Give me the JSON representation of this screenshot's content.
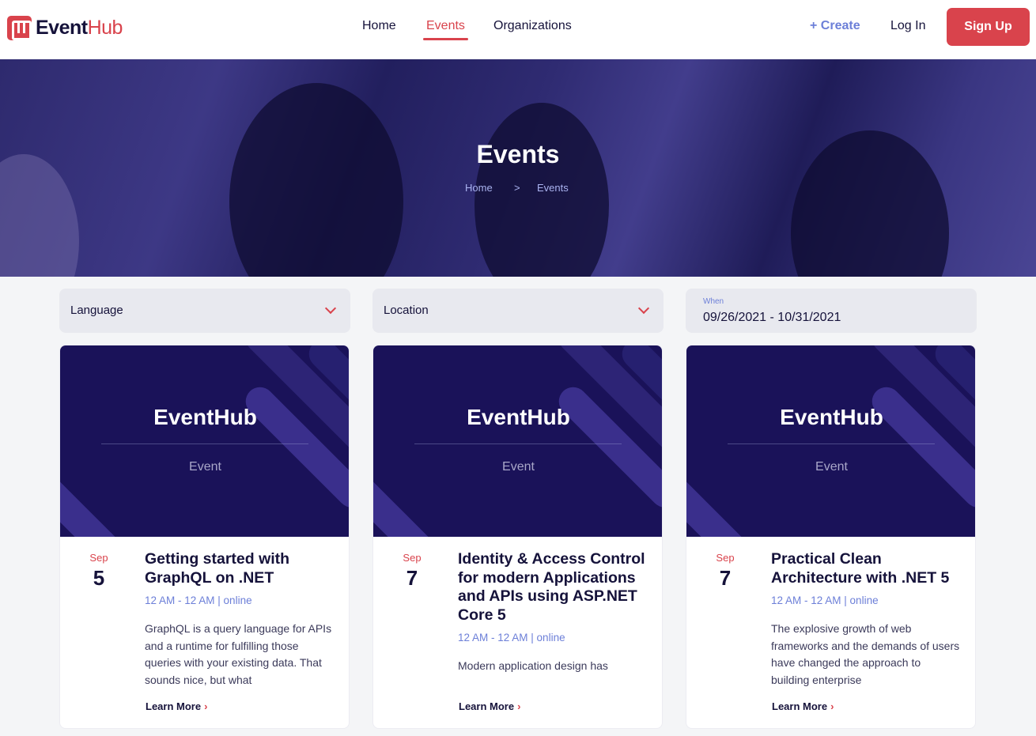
{
  "brand": {
    "name_part1": "Event",
    "name_part2": "Hub"
  },
  "nav": {
    "items": [
      "Home",
      "Events",
      "Organizations"
    ],
    "active": "Events"
  },
  "header_actions": {
    "create": "+ Create",
    "login": "Log In",
    "signup": "Sign Up"
  },
  "hero": {
    "title": "Events",
    "breadcrumb": [
      "Home",
      ">",
      "Events"
    ]
  },
  "filters": {
    "language": "Language",
    "location": "Location",
    "when_label": "When",
    "when_value": "09/26/2021 - 10/31/2021"
  },
  "cards": [
    {
      "banner_title": "EventHub",
      "banner_sub": "Event",
      "month": "Sep",
      "day": "5",
      "title": "Getting started with GraphQL on .NET",
      "meta": "12 AM - 12 AM | online",
      "description": "GraphQL is a query language for APIs and a runtime for fulfilling those queries with your existing data. That sounds nice, but what",
      "more": "Learn More"
    },
    {
      "banner_title": "EventHub",
      "banner_sub": "Event",
      "month": "Sep",
      "day": "7",
      "title": "Identity & Access Control for modern Applications and APIs using ASP.NET Core 5",
      "meta": "12 AM - 12 AM | online",
      "description": "Modern application design has",
      "more": "Learn More"
    },
    {
      "banner_title": "EventHub",
      "banner_sub": "Event",
      "month": "Sep",
      "day": "7",
      "title": "Practical Clean Architecture with .NET 5",
      "meta": "12 AM - 12 AM | online",
      "description": "The explosive growth of web frameworks and the demands of users have changed the approach to building enterprise",
      "more": "Learn More"
    }
  ],
  "colors": {
    "accent": "#d9434c",
    "link": "#6c7fd8",
    "navy": "#15123a",
    "banner": "#1a1259"
  }
}
